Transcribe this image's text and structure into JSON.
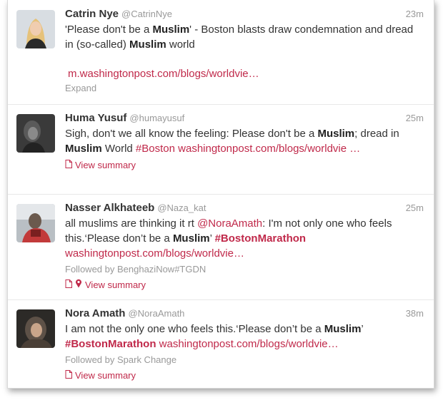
{
  "tweets": [
    {
      "name": "Catrin Nye",
      "handle": "@CatrinNye",
      "time": "23m",
      "text_parts": [
        {
          "t": "'Please don't be a ",
          "s": "plain"
        },
        {
          "t": "Muslim",
          "s": "bold"
        },
        {
          "t": "' - Boston blasts draw condemnation and dread in (so-called) ",
          "s": "plain"
        },
        {
          "t": "Muslim",
          "s": "bold"
        },
        {
          "t": " world",
          "s": "plain"
        }
      ],
      "link": "m.washingtonpost.com/blogs/worldvie…",
      "expand": "Expand"
    },
    {
      "name": "Huma Yusuf",
      "handle": "@humayusuf",
      "time": "25m",
      "text_parts": [
        {
          "t": "Sigh, don't we all know the feeling: Please don't be a ",
          "s": "plain"
        },
        {
          "t": "Muslim",
          "s": "bold"
        },
        {
          "t": "; dread in ",
          "s": "plain"
        },
        {
          "t": "Muslim",
          "s": "bold"
        },
        {
          "t": " World ",
          "s": "plain"
        },
        {
          "t": "#Boston",
          "s": "link"
        },
        {
          "t": " ",
          "s": "plain"
        },
        {
          "t": "washingtonpost.com/blogs/worldvie …",
          "s": "link"
        }
      ],
      "summary": "View summary"
    },
    {
      "name": "Nasser Alkhateeb",
      "handle": "@Naza_kat",
      "time": "25m",
      "text_parts": [
        {
          "t": "all muslims are thinking it rt ",
          "s": "plain"
        },
        {
          "t": "@NoraAmath",
          "s": "link"
        },
        {
          "t": ": I'm not only one who feels this.‘Please don’t be a ",
          "s": "plain"
        },
        {
          "t": "Muslim",
          "s": "bold"
        },
        {
          "t": "’ ",
          "s": "plain"
        },
        {
          "t": "#BostonMarathon",
          "s": "linkbold"
        },
        {
          "t": " ",
          "s": "plain"
        },
        {
          "t": "washingtonpost.com/blogs/worldvie…",
          "s": "link"
        }
      ],
      "followed": "Followed by BenghaziNow#TGDN",
      "summary": "View summary"
    },
    {
      "name": "Nora Amath",
      "handle": "@NoraAmath",
      "time": "38m",
      "text_parts": [
        {
          "t": "I am not the only one who feels this.‘Please don’t be a ",
          "s": "plain"
        },
        {
          "t": "Muslim",
          "s": "bold"
        },
        {
          "t": "’ ",
          "s": "plain"
        },
        {
          "t": "#BostonMarathon",
          "s": "linkbold"
        },
        {
          "t": " ",
          "s": "plain"
        },
        {
          "t": "washingtonpost.com/blogs/worldvie…",
          "s": "link"
        }
      ],
      "followed": "Followed by Spark Change",
      "summary": "View summary"
    }
  ],
  "colors": {
    "accent": "#c0294a",
    "muted": "#999999",
    "text": "#333333"
  },
  "icons": [
    "document-icon",
    "map-pin-icon"
  ]
}
